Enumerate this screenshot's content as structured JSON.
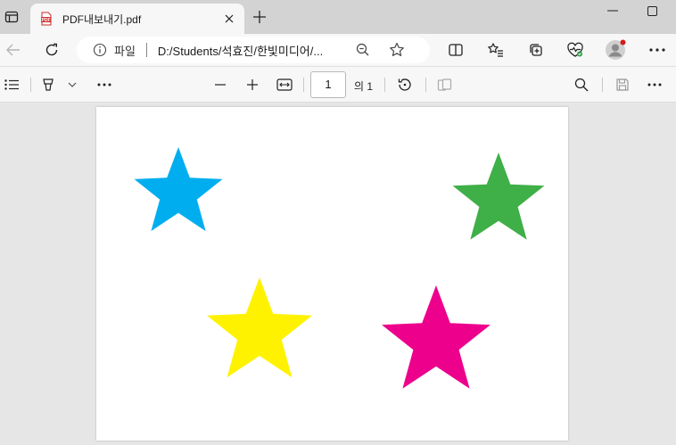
{
  "tab": {
    "title": "PDF내보내기.pdf"
  },
  "address": {
    "site_label": "파일",
    "url": "D:/Students/석효진/한빛미디어/..."
  },
  "pdf_toolbar": {
    "page_value": "1",
    "page_total": "의 1"
  },
  "stars": [
    {
      "color": "#00AEEF"
    },
    {
      "color": "#3FAF47"
    },
    {
      "color": "#FFF200"
    },
    {
      "color": "#EC008C"
    }
  ],
  "icons": {
    "tab_sidebar": "tab-actions-icon",
    "favicon": "pdf-file-icon",
    "close": "close-icon",
    "new_tab": "plus-icon",
    "back": "back-arrow-icon",
    "refresh": "refresh-icon",
    "info": "info-icon",
    "zoom": "zoom-out-icon",
    "favorite": "star-outline-icon",
    "split": "split-screen-icon",
    "favorites": "favorites-list-icon",
    "collections": "collections-icon",
    "health": "browser-essentials-icon",
    "profile": "profile-avatar-icon",
    "more": "more-dots-icon",
    "contents": "table-of-contents-icon",
    "draw": "draw-icon",
    "zoom_out": "minus-icon",
    "zoom_in": "plus-icon",
    "fit": "fit-width-icon",
    "rotate": "rotate-icon",
    "two_page": "page-view-icon",
    "find": "search-icon",
    "save": "save-icon"
  }
}
